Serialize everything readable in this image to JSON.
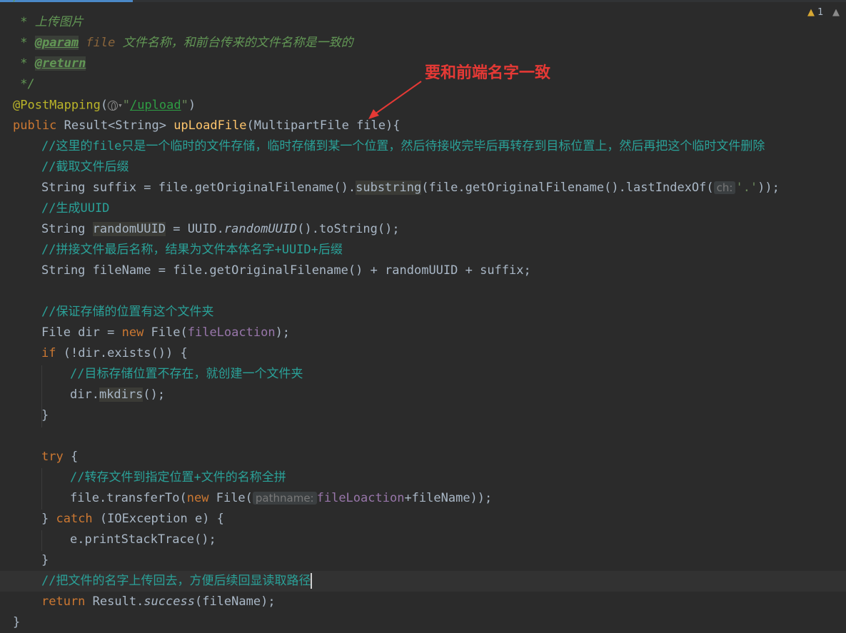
{
  "editor": {
    "warning_count": "1",
    "callout_text": "要和前端名字一致"
  },
  "code": {
    "l0": "/**",
    "doc_title": " * 上传图片",
    "param_tag": "@param",
    "param_name": "file",
    "param_desc": " 文件名称，和前台传来的文件名称是一致的",
    "doc_star": " * ",
    "return_tag": "@return",
    "doc_end": " */",
    "annotation": "@PostMapping",
    "mapping_path": "/upload",
    "public_kw": "public",
    "return_type": " Result<String> ",
    "method_name": "upLoadFile",
    "method_params": "(MultipartFile file){",
    "c1": "//这里的file只是一个临时的文件存储，临时存储到某一个位置，然后待接收完毕后再转存到目标位置上，然后再把这个临时文件删除",
    "c2": "//截取文件后缀",
    "suffix_a": "String suffix = file.getOriginalFilename().",
    "substring": "substring",
    "suffix_b": "(file.getOriginalFilename().lastIndexOf(",
    "hint_ch": "ch:",
    "dot_char": "'.'",
    "suffix_c": "));",
    "c3": "//生成UUID",
    "uuid_a": "String ",
    "uuid_var": "randomUUID",
    "uuid_b": " = UUID.",
    "uuid_method": "randomUUID",
    "uuid_c": "().toString();",
    "c4": "//拼接文件最后名称，结果为文件本体名字+UUID+后缀",
    "fname": "String fileName = file.getOriginalFilename() + randomUUID + suffix;",
    "c5": "//保证存储的位置有这个文件夹",
    "dir_a": "File dir = ",
    "new_kw": "new",
    "dir_b": " File(",
    "field_loc": "fileLoaction",
    "dir_c": ");",
    "if_kw": "if",
    "if_rest": " (!dir.exists()) {",
    "c6": "//目标存储位置不存在，就创建一个文件夹",
    "mk_a": "dir.",
    "mkdirs": "mkdirs",
    "mk_b": "();",
    "close_brace": "}",
    "try_kw": "try",
    "try_rest": " {",
    "c7": "//转存文件到指定位置+文件的名称全拼",
    "tr_a": "file.transferTo(",
    "tr_b": " File(",
    "hint_path": "pathname:",
    "tr_c": "+fileName));",
    "catch_a": "} ",
    "catch_kw": "catch",
    "catch_b": " (IOException e) {",
    "print": "e.printStackTrace();",
    "c8": "//把文件的名字上传回去，方便后续回显读取路径",
    "return_kw": "return",
    "ret_a": " Result.",
    "success": "success",
    "ret_b": "(fileName);",
    "final_brace": "}"
  },
  "colors": {
    "background": "#2b2b2b",
    "keyword": "#cc7832",
    "comment": "#2aa198",
    "method": "#ffc66d",
    "field": "#9876aa",
    "callout": "#e53935"
  }
}
